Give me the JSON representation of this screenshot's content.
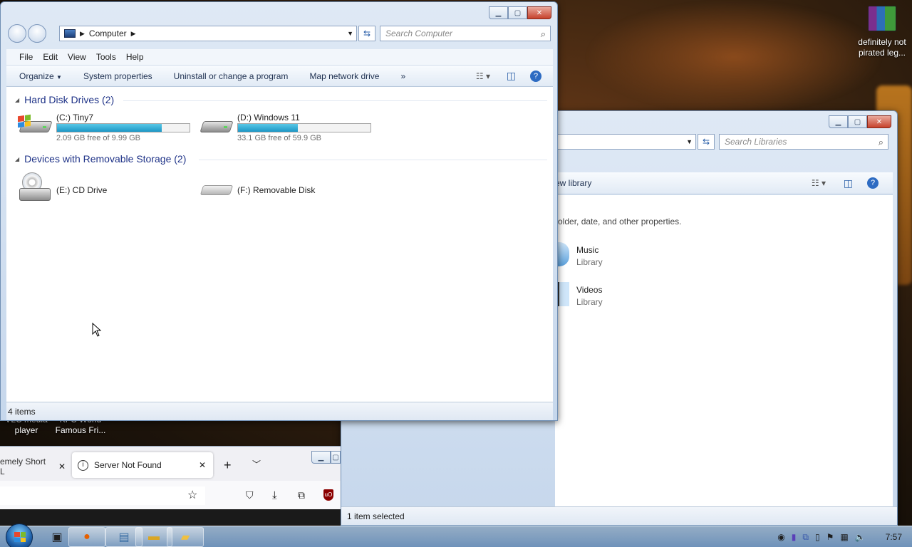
{
  "desktop": {
    "icon_winrar_label": "definitely not pirated leg...",
    "icon_vlc_label": "VLC media player",
    "icon_kfc_label": "KFC World Famous Fri..."
  },
  "explorer": {
    "address_root": "Computer",
    "search_placeholder": "Search Computer",
    "menu": [
      "File",
      "Edit",
      "View",
      "Tools",
      "Help"
    ],
    "toolbar": {
      "organize": "Organize",
      "system_properties": "System properties",
      "uninstall": "Uninstall or change a program",
      "map_drive": "Map network drive",
      "more": "»"
    },
    "groups": {
      "hdd_title": "Hard Disk Drives (2)",
      "removable_title": "Devices with Removable Storage (2)"
    },
    "drives": [
      {
        "name": "(C:) Tiny7",
        "free": "2.09 GB free of 9.99 GB",
        "used_fraction": 0.79
      },
      {
        "name": "(D:) Windows 11",
        "free": "33.1 GB free of 59.9 GB",
        "used_fraction": 0.45
      }
    ],
    "removable": [
      {
        "name": "(E:) CD Drive"
      },
      {
        "name": "(F:) Removable Disk"
      }
    ],
    "status": "4 items"
  },
  "libraries": {
    "search_placeholder": "Search Libraries",
    "toolbar_fragment": "ew library",
    "info_fragment": "older, date, and other properties.",
    "items": [
      {
        "name": "Music",
        "type": "Library"
      },
      {
        "name": "Videos",
        "type": "Library"
      }
    ],
    "status": "1 item selected"
  },
  "firefox": {
    "tab1_title": "emely Short L",
    "tab2_title": "Server Not Found",
    "new_tab": "+"
  },
  "taskbar": {
    "clock": "7:57"
  }
}
